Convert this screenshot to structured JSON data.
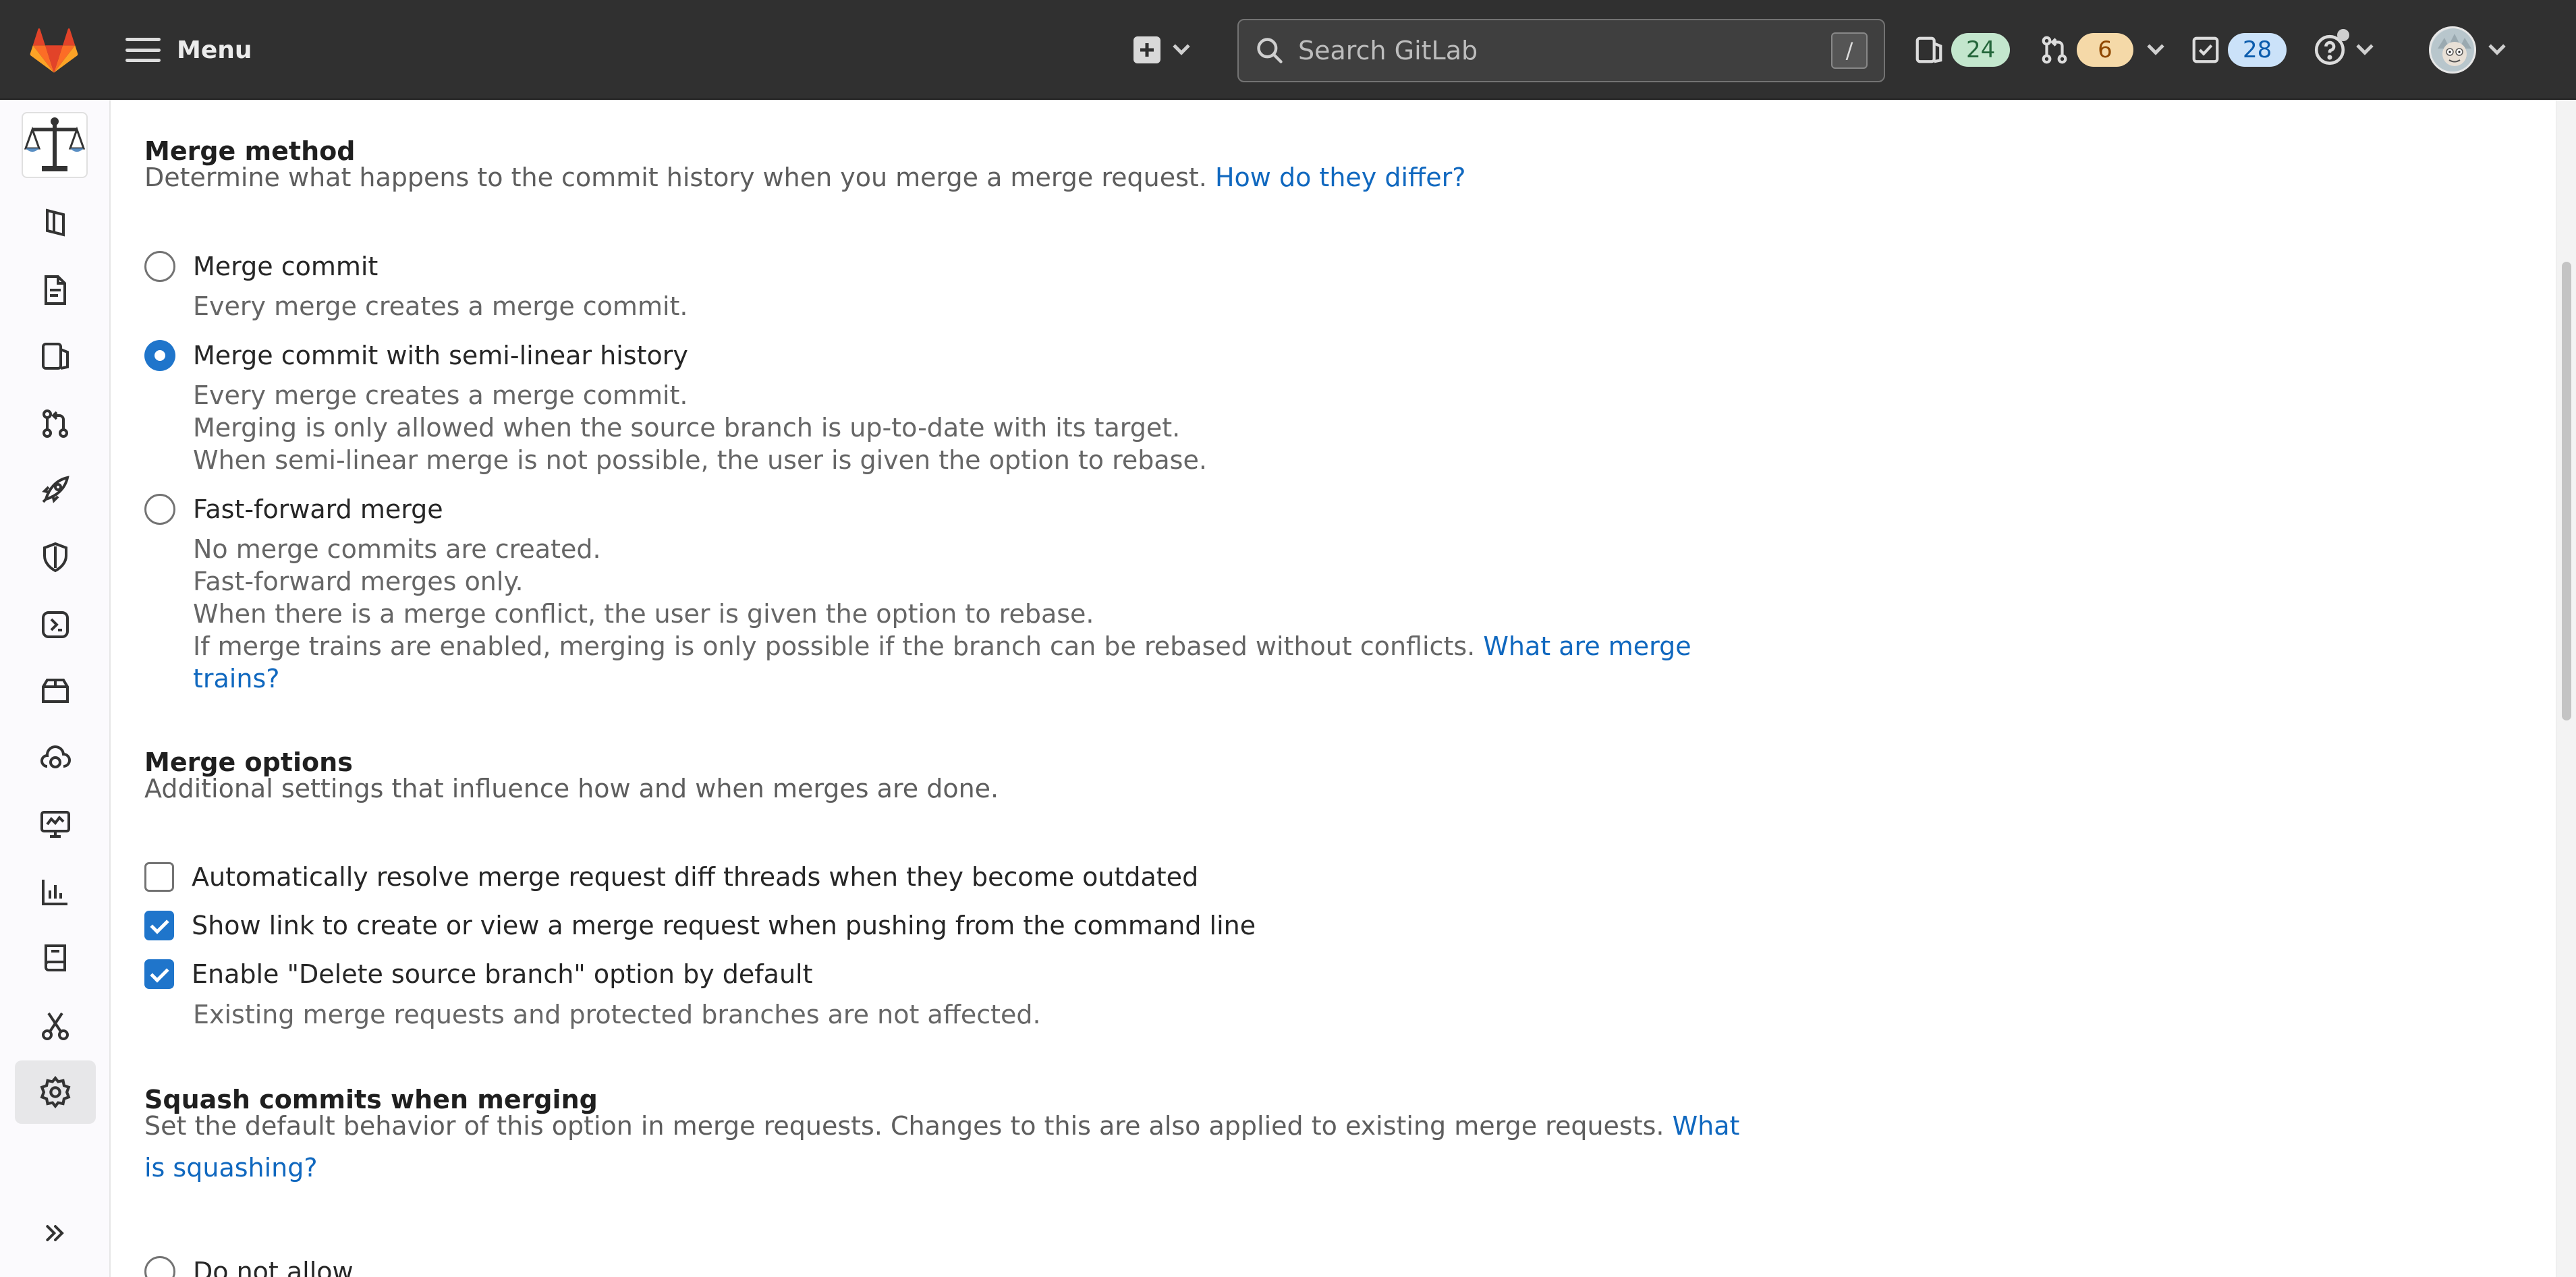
{
  "topbar": {
    "menu_label": "Menu",
    "search_placeholder": "Search GitLab",
    "search_shortcut": "/",
    "issues_count": "24",
    "merge_requests_count": "6",
    "todos_count": "28"
  },
  "sidebar": {
    "items": [
      {
        "name": "project-information",
        "icon": "project-icon"
      },
      {
        "name": "repository",
        "icon": "doc-icon"
      },
      {
        "name": "issues",
        "icon": "issues-icon"
      },
      {
        "name": "merge-requests",
        "icon": "merge-request-icon"
      },
      {
        "name": "ci-cd",
        "icon": "rocket-icon"
      },
      {
        "name": "security-compliance",
        "icon": "shield-icon"
      },
      {
        "name": "deployments",
        "icon": "deployments-icon"
      },
      {
        "name": "packages-registries",
        "icon": "package-icon"
      },
      {
        "name": "infrastructure",
        "icon": "cloud-gear-icon"
      },
      {
        "name": "monitor",
        "icon": "monitor-icon"
      },
      {
        "name": "analytics",
        "icon": "chart-icon"
      },
      {
        "name": "wiki",
        "icon": "book-icon"
      },
      {
        "name": "snippets",
        "icon": "scissors-icon"
      },
      {
        "name": "settings",
        "icon": "gear-icon",
        "active": true
      }
    ]
  },
  "merge_method": {
    "title": "Merge method",
    "description": "Determine what happens to the commit history when you merge a merge request.",
    "link": "How do they differ?",
    "options": [
      {
        "label": "Merge commit",
        "checked": false,
        "help": [
          "Every merge creates a merge commit."
        ]
      },
      {
        "label": "Merge commit with semi-linear history",
        "checked": true,
        "help": [
          "Every merge creates a merge commit.",
          "Merging is only allowed when the source branch is up-to-date with its target.",
          "When semi-linear merge is not possible, the user is given the option to rebase."
        ]
      },
      {
        "label": "Fast-forward merge",
        "checked": false,
        "help": [
          "No merge commits are created.",
          "Fast-forward merges only.",
          "When there is a merge conflict, the user is given the option to rebase.",
          "If merge trains are enabled, merging is only possible if the branch can be rebased without conflicts."
        ],
        "help_link": "What are merge trains?"
      }
    ]
  },
  "merge_options": {
    "title": "Merge options",
    "description": "Additional settings that influence how and when merges are done.",
    "options": [
      {
        "label": "Automatically resolve merge request diff threads when they become outdated",
        "checked": false
      },
      {
        "label": "Show link to create or view a merge request when pushing from the command line",
        "checked": true
      },
      {
        "label": "Enable \"Delete source branch\" option by default",
        "checked": true,
        "help": "Existing merge requests and protected branches are not affected."
      }
    ]
  },
  "squash": {
    "title": "Squash commits when merging",
    "description": "Set the default behavior of this option in merge requests. Changes to this are also applied to existing merge requests.",
    "link": "What is squashing?",
    "options": [
      {
        "label": "Do not allow",
        "checked": false
      }
    ]
  },
  "colors": {
    "topbar_bg": "#303030",
    "accent": "#1f75cb",
    "link": "#1068bf",
    "logo": "#fc6d26"
  }
}
